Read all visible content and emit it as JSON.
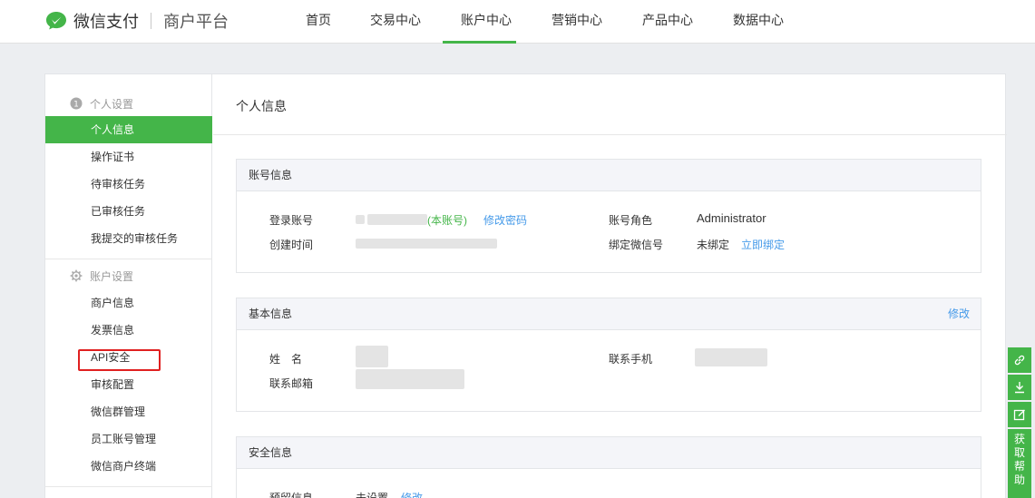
{
  "header": {
    "brand": "微信支付",
    "brand_sub": "商户平台",
    "nav": [
      "首页",
      "交易中心",
      "账户中心",
      "营销中心",
      "产品中心",
      "数据中心"
    ],
    "active_nav": "账户中心"
  },
  "sidebar": {
    "group1_title": "个人设置",
    "group1_items": [
      "个人信息",
      "操作证书",
      "待审核任务",
      "已审核任务",
      "我提交的审核任务"
    ],
    "group2_title": "账户设置",
    "group2_items": [
      "商户信息",
      "发票信息",
      "API安全",
      "审核配置",
      "微信群管理",
      "员工账号管理",
      "微信商户终端"
    ]
  },
  "main": {
    "title": "个人信息",
    "account": {
      "heading": "账号信息",
      "login_label": "登录账号",
      "login_suffix": "(本账号)",
      "change_pwd": "修改密码",
      "created_label": "创建时间",
      "role_label": "账号角色",
      "role_value": "Administrator",
      "wechat_label": "绑定微信号",
      "wechat_value": "未绑定",
      "bind_now": "立即绑定"
    },
    "basic": {
      "heading": "基本信息",
      "edit": "修改",
      "name_label": "姓　名",
      "phone_label": "联系手机",
      "email_label": "联系邮箱"
    },
    "security": {
      "heading": "安全信息",
      "reserved_label": "预留信息",
      "reserved_value": "未设置",
      "edit": "修改"
    }
  },
  "float_help": {
    "help_text": [
      "获",
      "取",
      "帮",
      "助"
    ]
  },
  "colors": {
    "accent": "#44b549",
    "link": "#459ae9",
    "highlight": "#e02020"
  }
}
